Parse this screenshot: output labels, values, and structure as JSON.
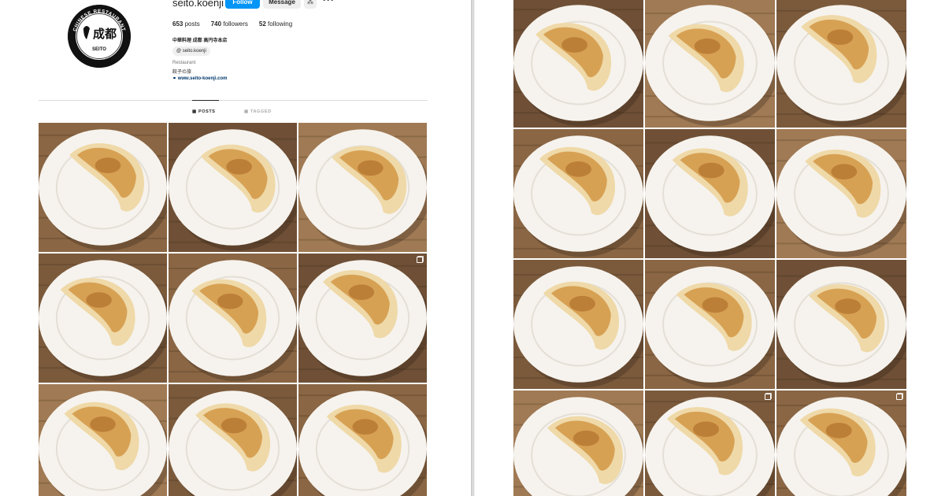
{
  "profile": {
    "username": "seito.koenji",
    "follow_label": "Follow",
    "message_label": "Message",
    "suggest_icon": "add-person-icon",
    "more_icon": "more-icon",
    "posts_count": "653",
    "posts_label": "posts",
    "followers_count": "740",
    "followers_label": "followers",
    "following_count": "52",
    "following_label": "following",
    "full_name": "中華料理 成都 高円寺本店",
    "threads_handle": "seito.koenji",
    "category": "Restaurant",
    "bio": "餃子の旅",
    "website": "www.seito-koenji.com"
  },
  "logo": {
    "top_text": "CHINESE RESTAURANT",
    "kanji": "成都",
    "name": "SEITO",
    "since": "SINCE 1969"
  },
  "tabs": {
    "posts": "POSTS",
    "tagged": "TAGGED"
  },
  "colors": {
    "accent": "#0095f6",
    "wood_dark": "#6b4a2e",
    "wood_mid": "#9a7450",
    "plate": "#f7f4ef"
  }
}
